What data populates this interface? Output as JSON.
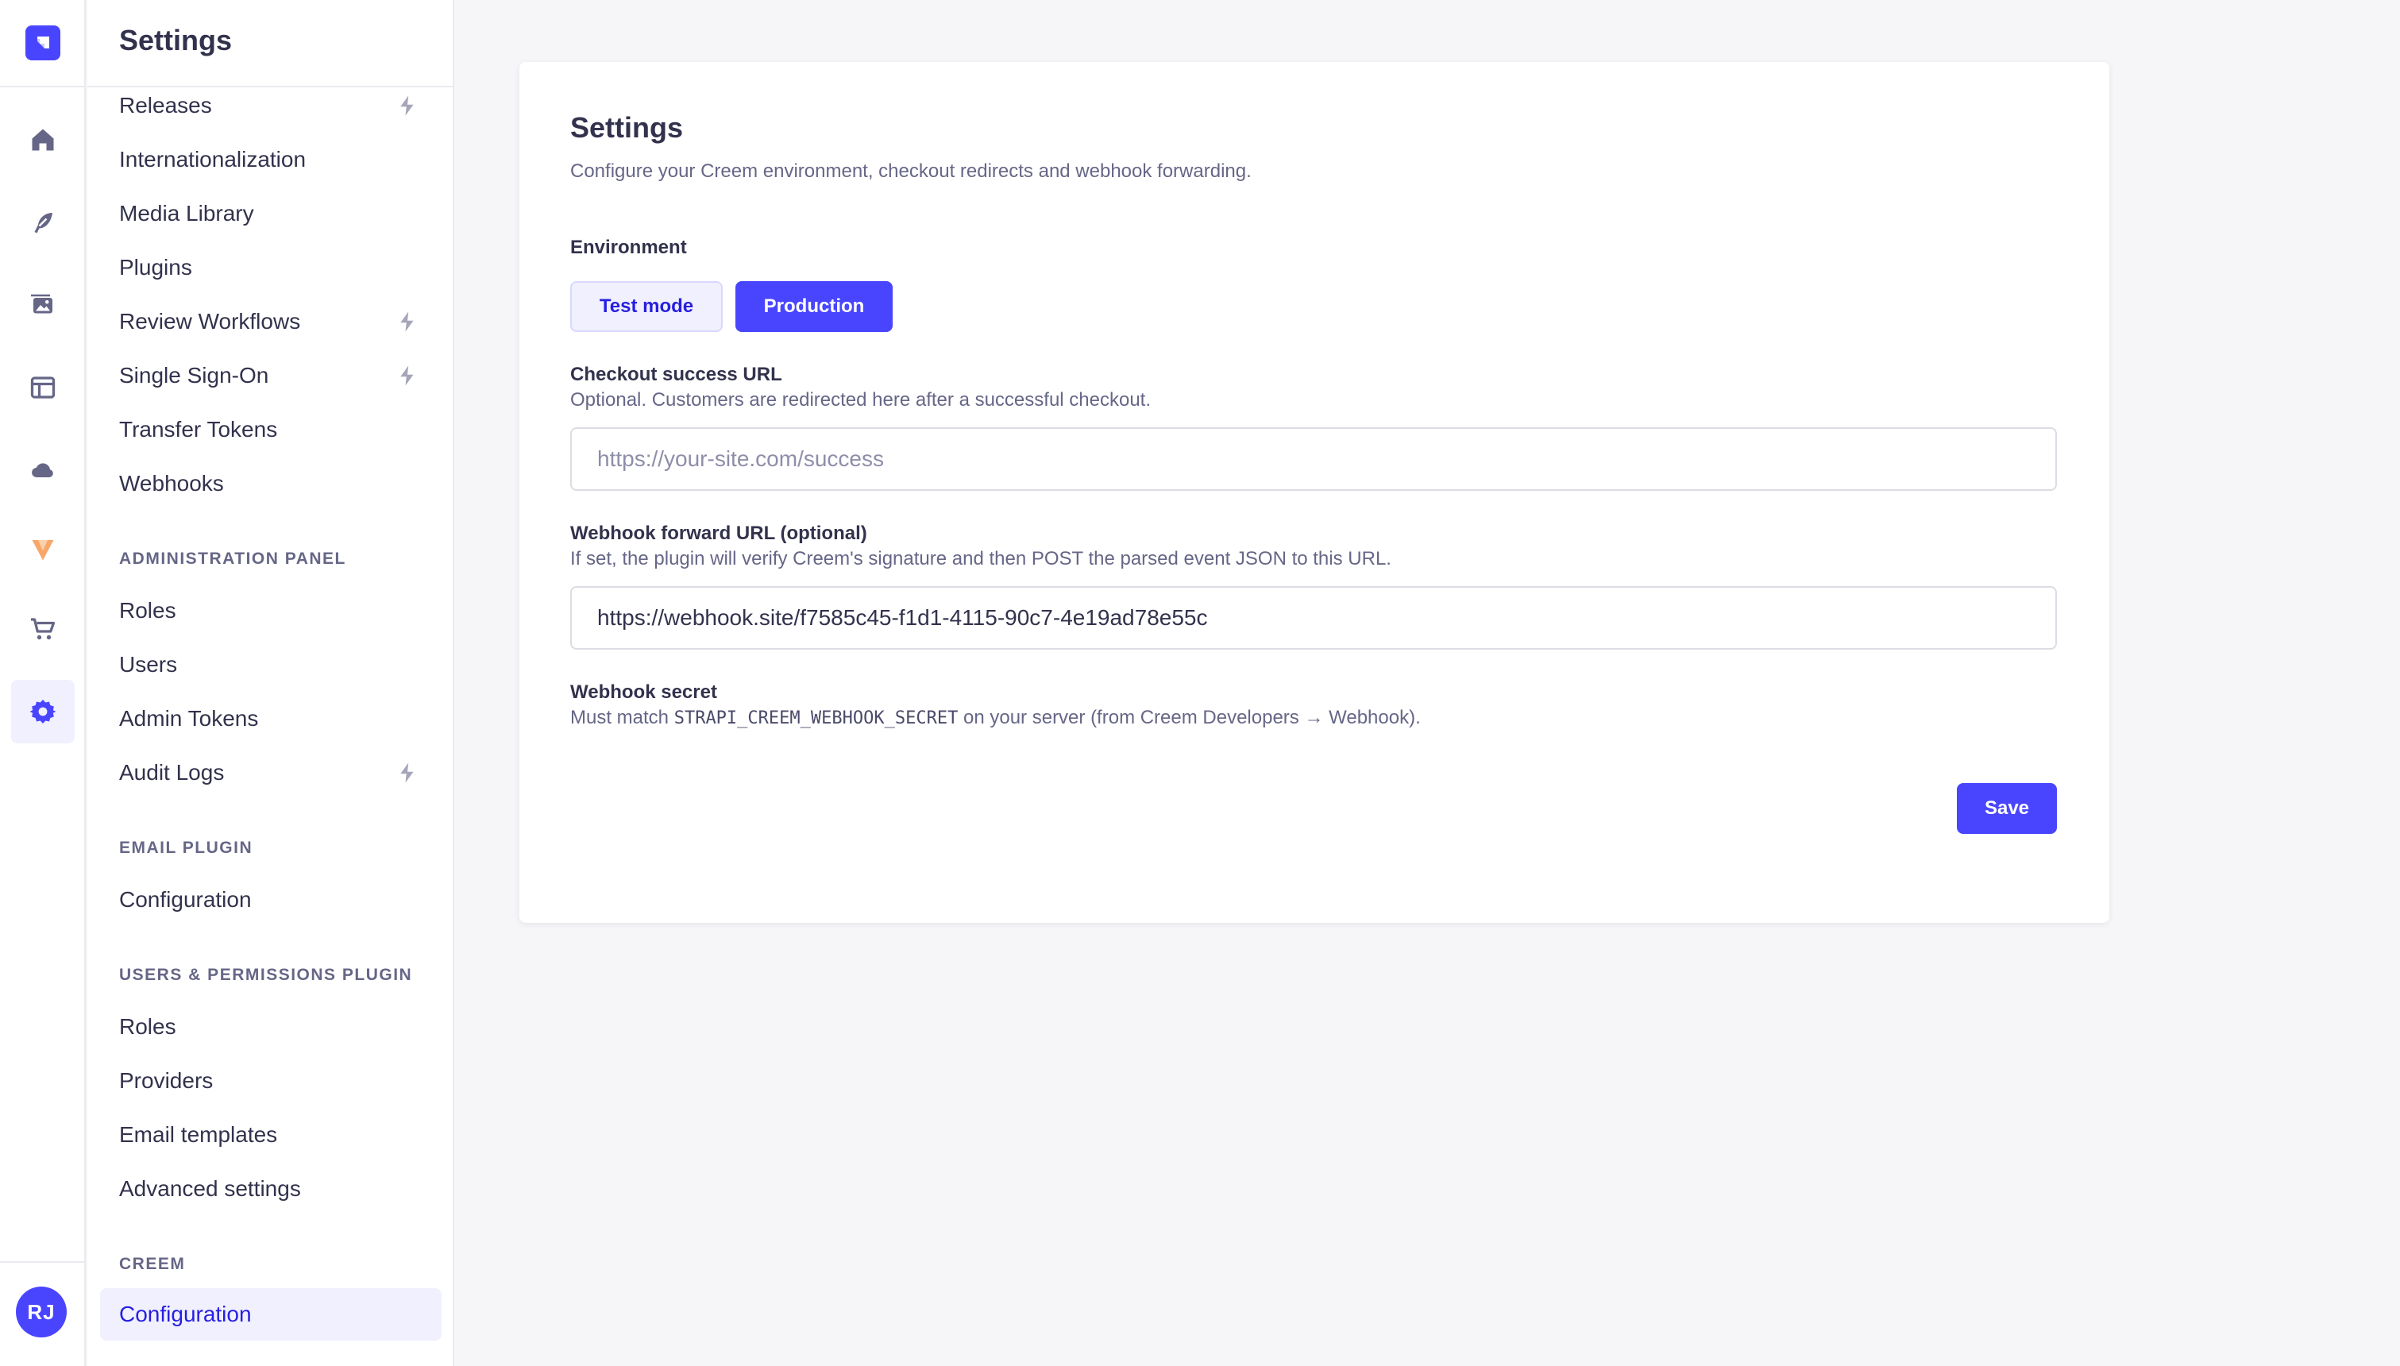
{
  "rail": {
    "avatar_initials": "RJ",
    "icons": [
      "strapi-logo-icon",
      "home-icon",
      "feather-icon",
      "media-icon",
      "layout-icon",
      "cloud-icon",
      "vite-icon",
      "cart-icon",
      "gear-icon"
    ]
  },
  "subnav": {
    "title": "Settings",
    "global_items": [
      {
        "label": "Releases",
        "bolt": true
      },
      {
        "label": "Internationalization",
        "bolt": false
      },
      {
        "label": "Media Library",
        "bolt": false
      },
      {
        "label": "Plugins",
        "bolt": false
      },
      {
        "label": "Review Workflows",
        "bolt": true
      },
      {
        "label": "Single Sign-On",
        "bolt": true
      },
      {
        "label": "Transfer Tokens",
        "bolt": false
      },
      {
        "label": "Webhooks",
        "bolt": false
      }
    ],
    "admin_section": "ADMINISTRATION PANEL",
    "admin_items": [
      {
        "label": "Roles",
        "bolt": false
      },
      {
        "label": "Users",
        "bolt": false
      },
      {
        "label": "Admin Tokens",
        "bolt": false
      },
      {
        "label": "Audit Logs",
        "bolt": true
      }
    ],
    "email_section": "EMAIL PLUGIN",
    "email_items": [
      {
        "label": "Configuration"
      }
    ],
    "up_section": "USERS & PERMISSIONS PLUGIN",
    "up_items": [
      {
        "label": "Roles"
      },
      {
        "label": "Providers"
      },
      {
        "label": "Email templates"
      },
      {
        "label": "Advanced settings"
      }
    ],
    "creem_section": "CREEM",
    "creem_items": [
      {
        "label": "Configuration",
        "active": true
      }
    ]
  },
  "main": {
    "title": "Settings",
    "description": "Configure your Creem environment, checkout redirects and webhook forwarding.",
    "environment": {
      "label": "Environment",
      "options": [
        "Test mode",
        "Production"
      ],
      "selected": "Production"
    },
    "checkout": {
      "label": "Checkout success URL",
      "hint": "Optional. Customers are redirected here after a successful checkout.",
      "value": "",
      "placeholder": "https://your-site.com/success"
    },
    "webhook": {
      "label": "Webhook forward URL (optional)",
      "hint": "If set, the plugin will verify Creem's signature and then POST the parsed event JSON to this URL.",
      "value": "https://webhook.site/f7585c45-f1d1-4115-90c7-4e19ad78e55c"
    },
    "secret": {
      "label": "Webhook secret",
      "hint_prefix": "Must match ",
      "hint_code": "STRAPI_CREEM_WEBHOOK_SECRET",
      "hint_suffix": " on your server (from Creem Developers → Webhook)."
    },
    "save_label": "Save"
  },
  "colors": {
    "primary": "#4945ff",
    "primary_light": "#f0f0ff",
    "text": "#32324d",
    "muted": "#666687",
    "background": "#f6f6f9"
  }
}
